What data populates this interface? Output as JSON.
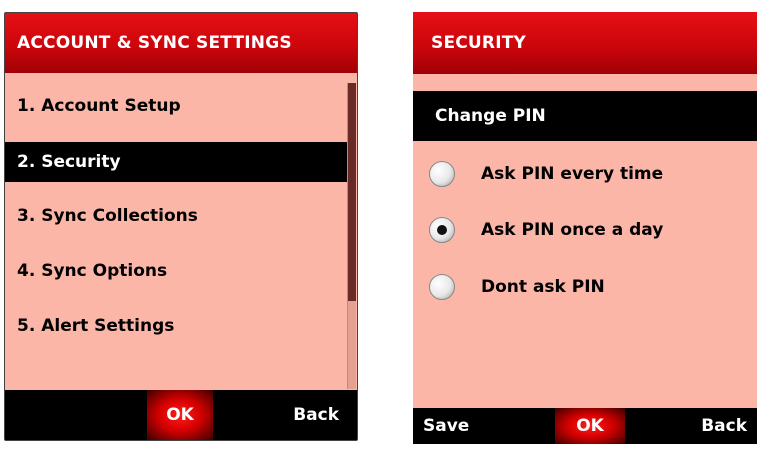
{
  "left_screen": {
    "title": "ACCOUNT & SYNC SETTINGS",
    "menu": [
      {
        "label": "1. Account Setup",
        "selected": false
      },
      {
        "label": "2. Security",
        "selected": true
      },
      {
        "label": "3. Sync Collections",
        "selected": false
      },
      {
        "label": "4. Sync Options",
        "selected": false
      },
      {
        "label": "5. Alert Settings",
        "selected": false
      }
    ],
    "softkeys": {
      "center": "OK",
      "right": "Back"
    }
  },
  "right_screen": {
    "title": "SECURITY",
    "subheader": "Change PIN",
    "options": [
      {
        "label": "Ask PIN every time",
        "checked": false
      },
      {
        "label": "Ask PIN once a day",
        "checked": true
      },
      {
        "label": "Dont ask PIN",
        "checked": false
      }
    ],
    "softkeys": {
      "left": "Save",
      "center": "OK",
      "right": "Back"
    }
  },
  "colors": {
    "title_red": "#cc060c",
    "content_pink": "#fbb6a8",
    "selection_black": "#000000"
  }
}
